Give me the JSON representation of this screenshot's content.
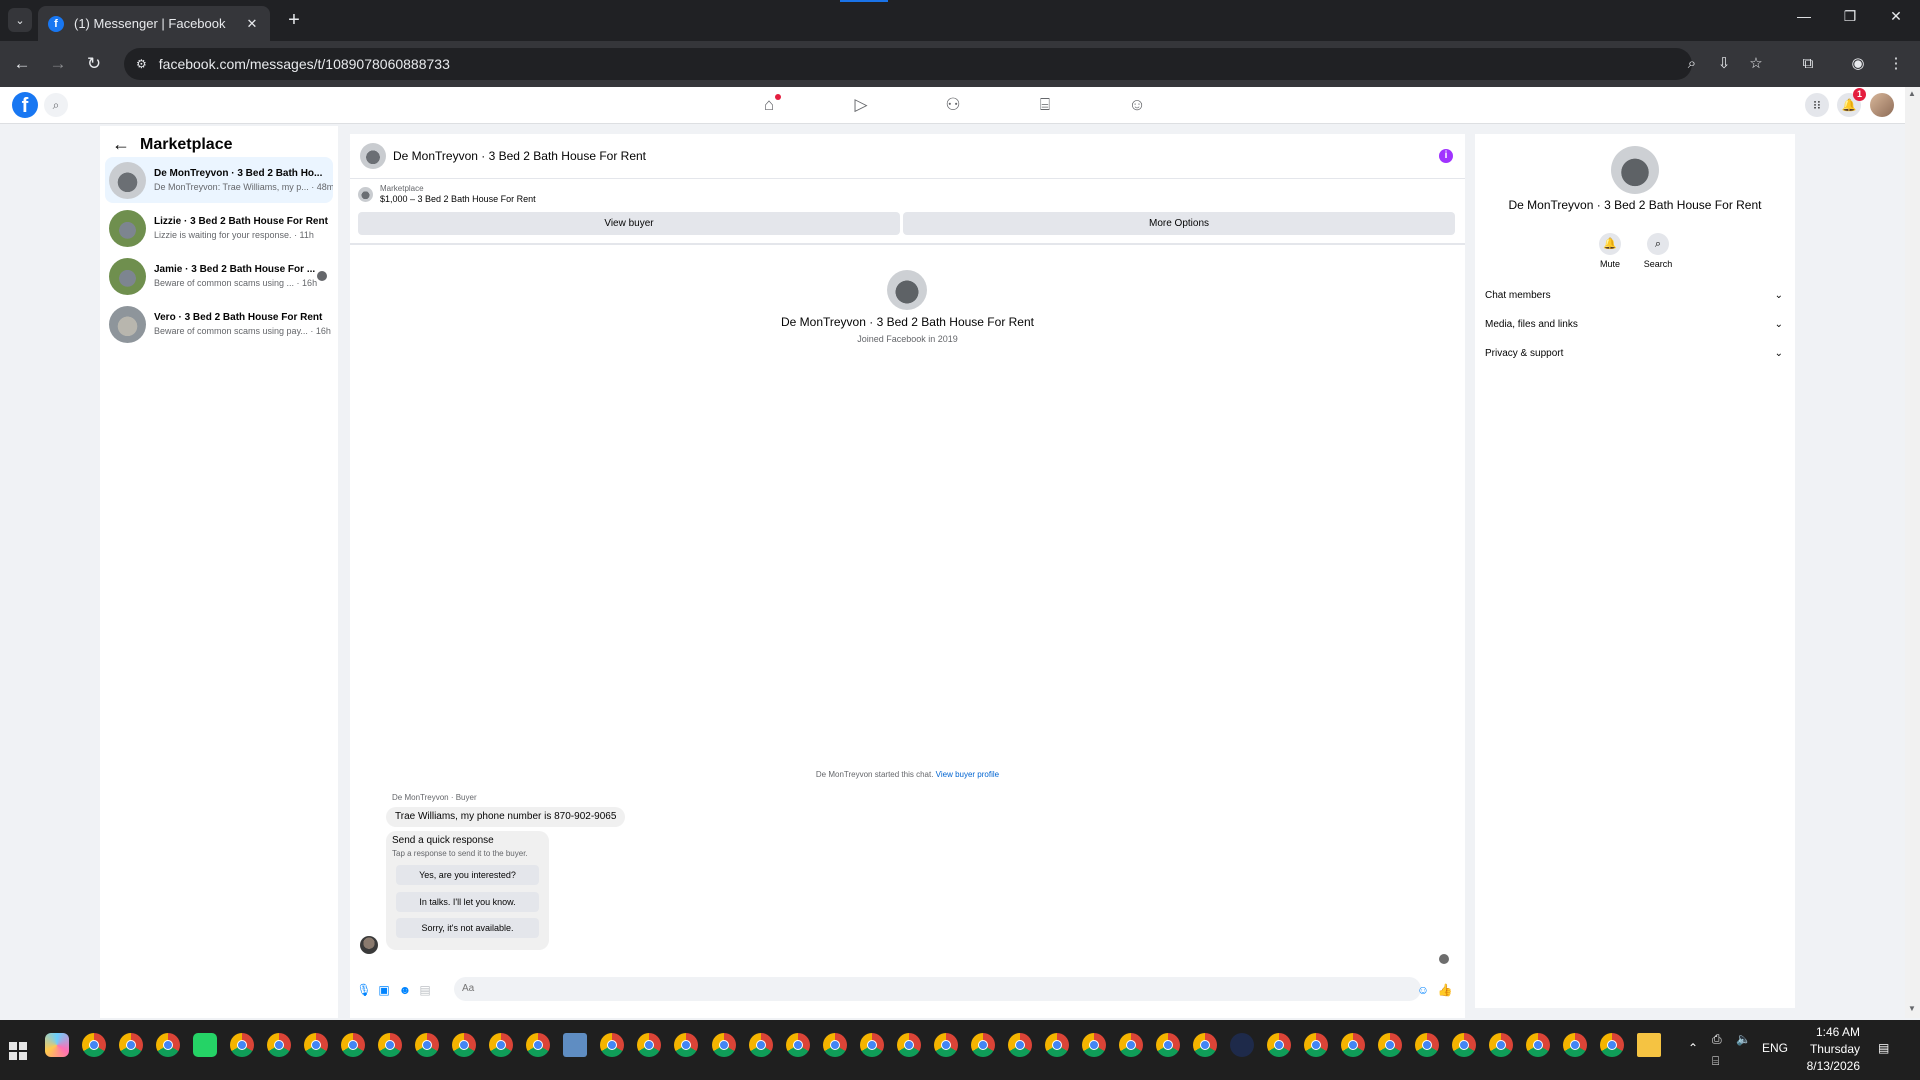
{
  "browser": {
    "tab_title": "(1) Messenger | Facebook",
    "tab_close": "✕",
    "new_tab": "+",
    "url": "facebook.com/messages/t/1089078060888733"
  },
  "fb_nav": {
    "logo_letter": "f",
    "notification_count": "1"
  },
  "sidebar": {
    "title": "Marketplace",
    "chats": [
      {
        "name": "De MonTreyvon · 3 Bed 2 Bath Ho...",
        "preview": "De MonTreyvon: Trae Williams, my p... · 48m"
      },
      {
        "name": "Lizzie · 3 Bed 2 Bath House For Rent",
        "preview": "Lizzie is waiting for your response. · 11h"
      },
      {
        "name": "Jamie · 3 Bed 2 Bath House For ...",
        "preview": "Beware of common scams using ... · 16h"
      },
      {
        "name": "Vero · 3 Bed 2 Bath House For Rent",
        "preview": "Beware of common scams using pay... · 16h"
      }
    ]
  },
  "conversation": {
    "header_name": "De MonTreyvon · 3 Bed 2 Bath House For Rent",
    "info_icon": "i",
    "listing_source": "Marketplace",
    "listing_title": "$1,000 – 3 Bed 2 Bath House For Rent",
    "view_buyer": "View buyer",
    "more_options": "More Options",
    "profile_name": "De MonTreyvon · 3 Bed 2 Bath House For Rent",
    "profile_sub": "Joined Facebook in 2019",
    "started_text": "De MonTreyvon started this chat.",
    "started_link": "View buyer profile",
    "sender_label": "De MonTreyvon · Buyer",
    "message": "Trae Williams, my phone number is 870-902-9065",
    "quick_title": "Send a quick response",
    "quick_sub": "Tap a response to send it to the buyer.",
    "quick_replies": [
      "Yes, are you interested?",
      "In talks. I'll let you know.",
      "Sorry, it's not available."
    ],
    "composer_placeholder": "Aa"
  },
  "info_panel": {
    "name": "De MonTreyvon · 3 Bed 2 Bath House For Rent",
    "mute": "Mute",
    "search": "Search",
    "sections": [
      "Chat members",
      "Media, files and links",
      "Privacy & support"
    ]
  },
  "taskbar": {
    "language": "ENG",
    "time": "1:46 AM",
    "day": "Thursday",
    "date": "8/13/2026"
  },
  "colors": {
    "facebook_blue": "#1877f2",
    "messenger_blue": "#0084ff",
    "info_purple": "#a033ff",
    "badge_red": "#e41e3f"
  }
}
